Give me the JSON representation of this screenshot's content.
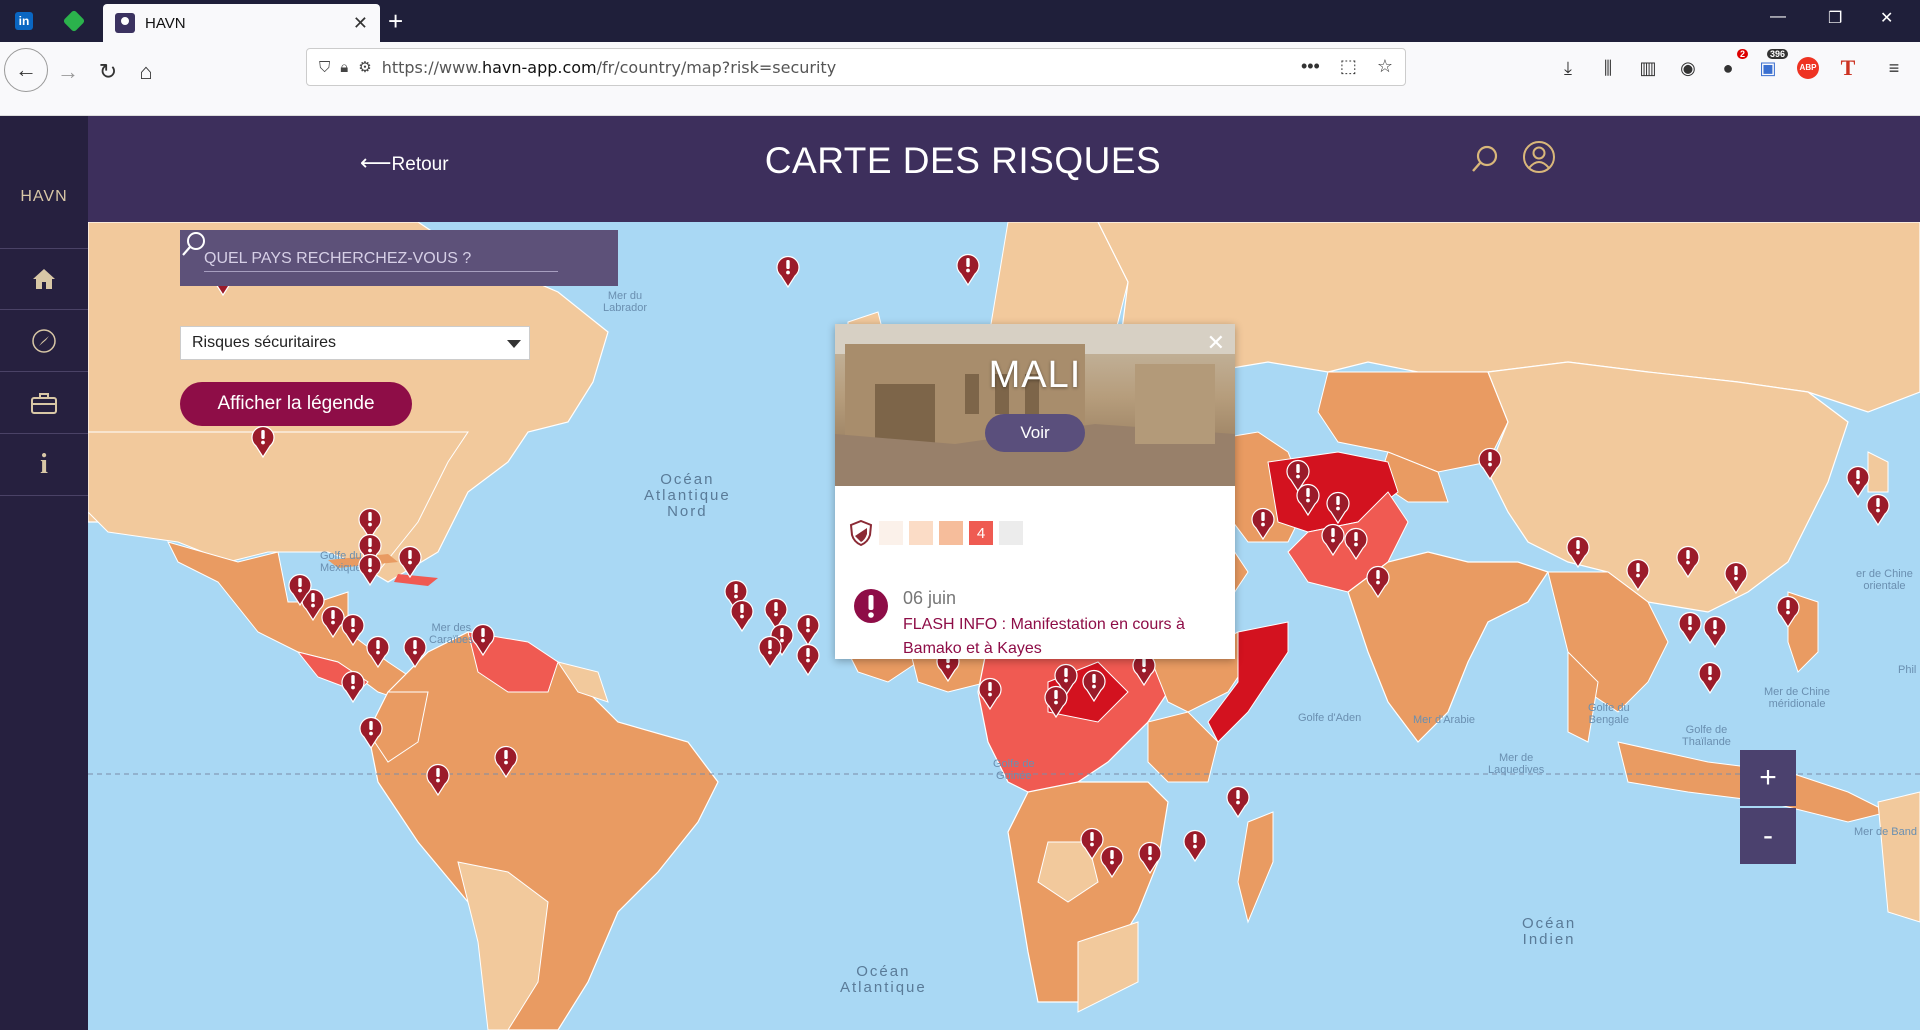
{
  "browser": {
    "tab_title": "HAVN",
    "url_prefix": "https://www.",
    "url_domain": "havn-app.com",
    "url_path": "/fr/country/map?risk=security",
    "badges": {
      "ext1": "2",
      "ext2": "396",
      "abp": "ABP"
    },
    "pinned": [
      "linkedin-icon",
      "feedly-icon"
    ]
  },
  "sidebar": {
    "brand": "HAVN",
    "items": [
      {
        "icon": "home-icon"
      },
      {
        "icon": "compass-icon"
      },
      {
        "icon": "toolbox-icon"
      },
      {
        "icon": "info-icon",
        "glyph": "i"
      }
    ]
  },
  "header": {
    "back_label": "Retour",
    "title": "CARTE DES RISQUES"
  },
  "search": {
    "placeholder": "QUEL PAYS RECHERCHEZ-VOUS ?"
  },
  "filter": {
    "selected": "Risques sécuritaires"
  },
  "legend_button": "Afficher la légende",
  "map_labels": {
    "mer_labrador": "Mer du\nLabrador",
    "golfe_mexique": "Golfe du\nMexique",
    "mer_caraibes": "Mer des\nCaraïbes",
    "ocean_atl_nord": "Océan\nAtlantique\nNord",
    "ocean_atl": "Océan\nAtlantique",
    "golfe_guinee": "Golfe de\nGuinée",
    "golfe_aden": "Golfe d'Aden",
    "mer_arabie": "Mer d'Arabie",
    "golfe_bengale": "Golfe du\nBengale",
    "mer_laquedives": "Mer de\nLaquedives",
    "golfe_thailande": "Golfe de\nThaïlande",
    "mer_chine_mer": "Mer de Chine\nméridionale",
    "mer_chine_or": "er de Chine\norientale",
    "mer_banda": "Mer de Band",
    "ocean_indien": "Océan\nIndien",
    "phil": "Phil"
  },
  "zoom": {
    "in": "+",
    "out": "-"
  },
  "popup": {
    "country": "MALI",
    "view_button": "Voir",
    "risk_level": "4",
    "risk_scale_colors": [
      "#fbf1ea",
      "#fbdcc6",
      "#f6bd9b",
      "#ef5b52",
      "#ececec"
    ],
    "alert_date": "06 juin",
    "alert_text": "FLASH INFO : Manifestation en cours à Bamako et à Kayes"
  },
  "colors": {
    "sidebar": "#26203f",
    "header": "#3d2f5c",
    "accent": "#8e0d47",
    "ocean": "#a9d8f4",
    "risk_low": "#f2c99c",
    "risk_mid": "#e99b62",
    "risk_high": "#f05a52",
    "risk_max": "#d3121f"
  }
}
